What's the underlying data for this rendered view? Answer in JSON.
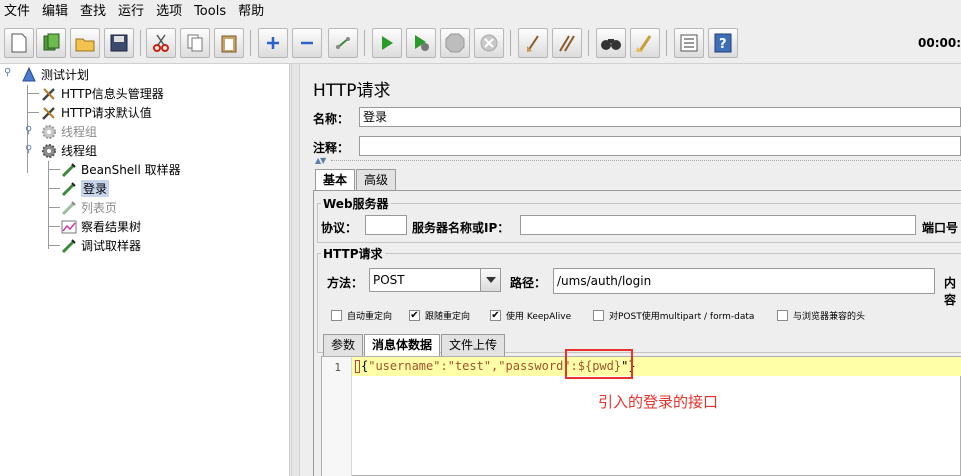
{
  "menu": [
    "文件",
    "编辑",
    "查找",
    "运行",
    "选项",
    "Tools",
    "帮助"
  ],
  "toolbar": {
    "icons": [
      "new-icon",
      "templates-icon",
      "open-icon",
      "save-icon",
      "cut-icon",
      "copy-icon",
      "paste-icon",
      "expand-icon",
      "collapse-icon",
      "toggle-icon",
      "start-icon",
      "start-no-pause-icon",
      "stop-icon",
      "shutdown-icon",
      "clear-icon",
      "clear-all-icon",
      "search-icon",
      "reset-search-icon",
      "function-helper-icon",
      "help-icon"
    ],
    "timer": "00:00:"
  },
  "tree": {
    "root": "测试计划",
    "header_manager": "HTTP信息头管理器",
    "defaults": "HTTP请求默认值",
    "thread_group_1": "线程组",
    "thread_group_2": "线程组",
    "beanshell": "BeanShell 取样器",
    "login": "登录",
    "list_page": "列表页",
    "results_tree": "察看结果树",
    "debug_sampler": "调试取样器"
  },
  "panel": {
    "title": "HTTP请求",
    "name_label": "名称：",
    "name_value": "登录",
    "comment_label": "注释：",
    "comment_value": "",
    "tabs": [
      "基本",
      "高级"
    ],
    "web_server": {
      "title": "Web服务器",
      "protocol_label": "协议：",
      "protocol_value": "",
      "server_label": "服务器名称或IP：",
      "server_value": "",
      "port_label": "端口号"
    },
    "http_request": {
      "title": "HTTP请求",
      "method_label": "方法：",
      "method_value": "POST",
      "path_label": "路径：",
      "path_value": "/ums/auth/login",
      "content_encoding_label": "内容"
    },
    "options": [
      {
        "label": "自动重定向",
        "checked": false
      },
      {
        "label": "跟随重定向",
        "checked": true
      },
      {
        "label": "使用 KeepAlive",
        "checked": true
      },
      {
        "label": "对POST使用multipart / form-data",
        "checked": false
      },
      {
        "label": "与浏览器兼容的头",
        "checked": false
      }
    ],
    "sub_tabs": [
      "参数",
      "消息体数据",
      "文件上传"
    ],
    "body": {
      "line_number": "1",
      "code_open": "{",
      "code_keys": "\"username\":\"test\",\"password\":",
      "code_var": "${pwd}",
      "code_close": "\"}"
    },
    "annotation": "引入的登录的接口"
  },
  "colors": {
    "highlight_line": "#ffffa8",
    "annotation_red": "#e8322c",
    "selection": "#c6d5ec"
  }
}
